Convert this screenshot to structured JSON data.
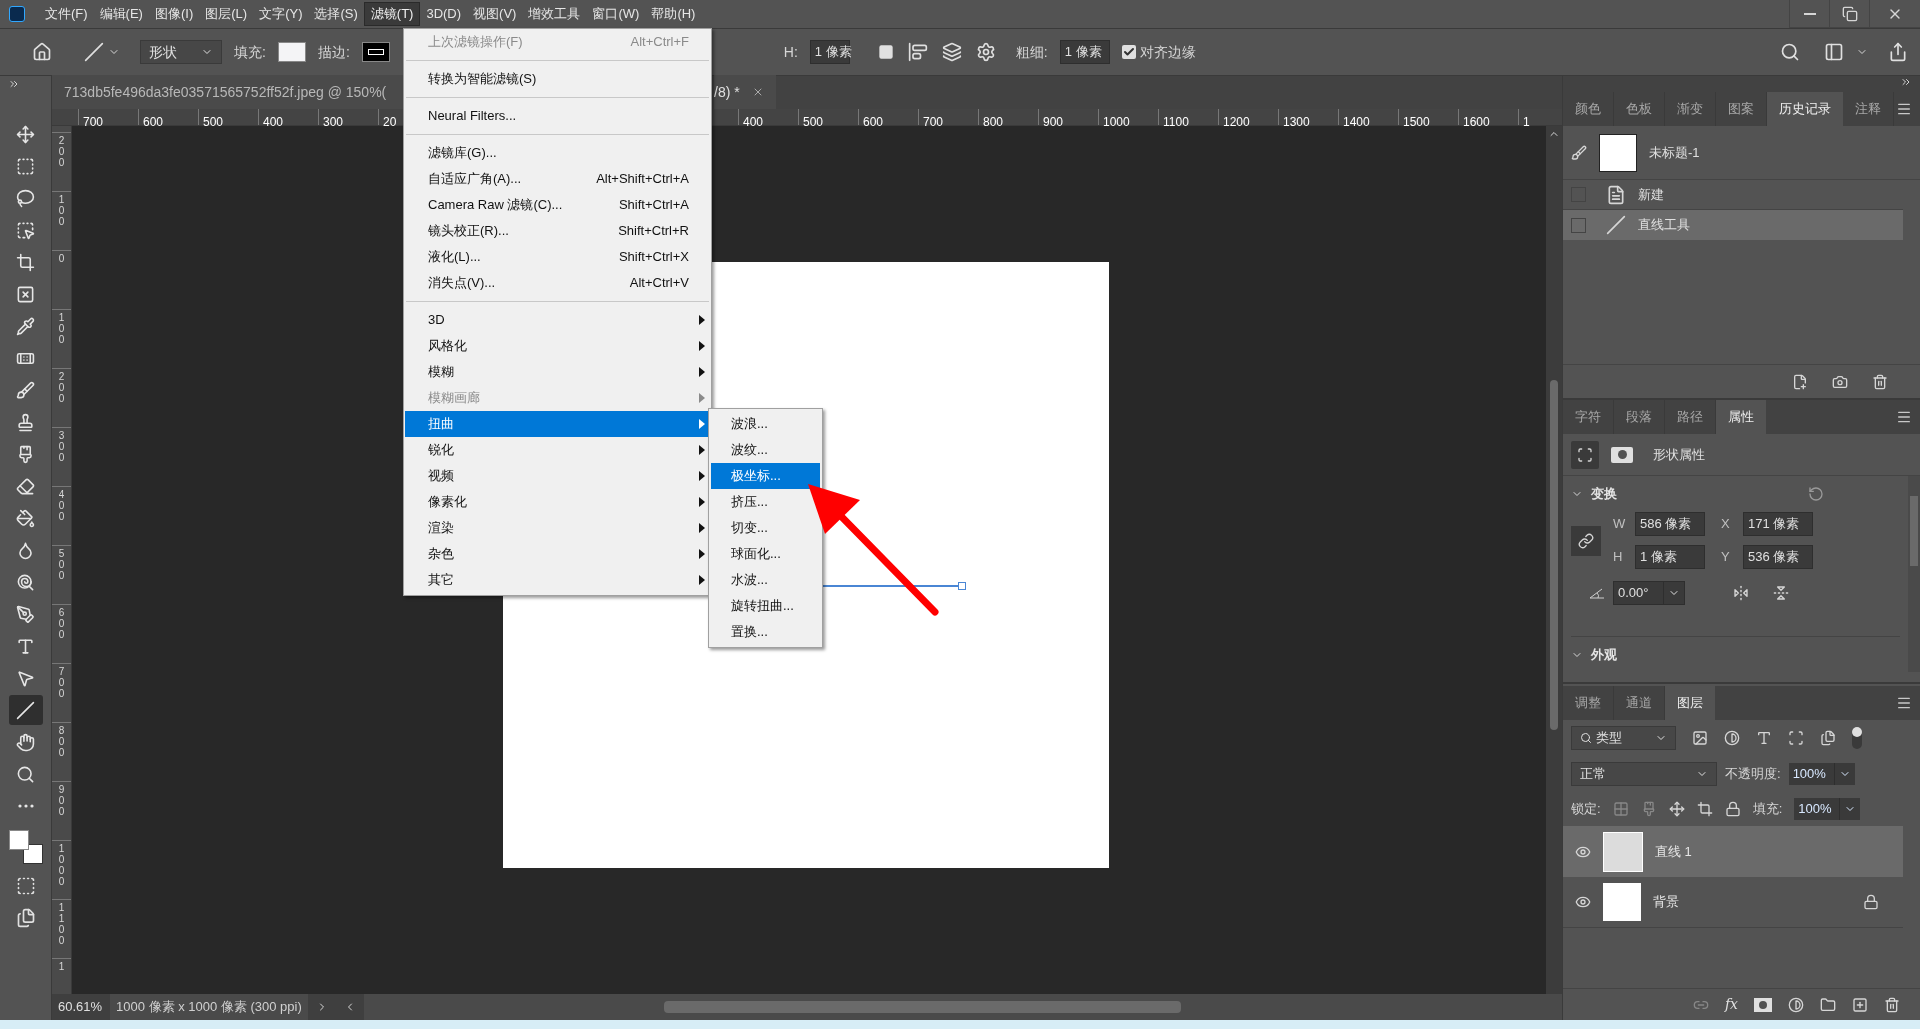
{
  "menu_bar": {
    "items": [
      {
        "label": "文件(F)",
        "selected": false
      },
      {
        "label": "编辑(E)",
        "selected": false
      },
      {
        "label": "图像(I)",
        "selected": false
      },
      {
        "label": "图层(L)",
        "selected": false
      },
      {
        "label": "文字(Y)",
        "selected": false
      },
      {
        "label": "选择(S)",
        "selected": false
      },
      {
        "label": "滤镜(T)",
        "selected": true
      },
      {
        "label": "3D(D)",
        "selected": false
      },
      {
        "label": "视图(V)",
        "selected": false
      },
      {
        "label": "增效工具",
        "selected": false
      },
      {
        "label": "窗口(W)",
        "selected": false
      },
      {
        "label": "帮助(H)",
        "selected": false
      }
    ]
  },
  "options_bar": {
    "shape_mode": "形状",
    "fill_label": "填充:",
    "stroke_label": "描边:",
    "h_label": "H:",
    "h_value": "1 像素",
    "weight_label": "粗细:",
    "weight_value": "1 像素",
    "align_edges": {
      "label": "对齐边缘",
      "checked": true
    }
  },
  "document_tab": {
    "title_start": "713db5fe496da3fe03571565752ff52f.jpeg @ 150%(",
    "title_end": "/8) *"
  },
  "ruler": {
    "left_labels": [
      "700",
      "600",
      "500",
      "400",
      "300",
      "20"
    ],
    "right_labels": [
      "400",
      "500",
      "600",
      "700",
      "800",
      "900",
      "1000",
      "1100",
      "1200",
      "1300",
      "1400",
      "1500",
      "1600",
      "1"
    ],
    "vertical_labels": [
      "200",
      "100",
      "0",
      "100",
      "200",
      "300",
      "400",
      "500",
      "600",
      "700",
      "800",
      "900",
      "1000",
      "1100",
      "1"
    ]
  },
  "tools": [
    {
      "selected": false
    },
    {
      "selected": false
    },
    {
      "selected": false
    },
    {
      "selected": false
    },
    {
      "selected": false
    },
    {
      "selected": false
    },
    {
      "selected": false
    },
    {
      "selected": false
    },
    {
      "selected": false
    },
    {
      "selected": false
    },
    {
      "selected": false
    },
    {
      "selected": false
    },
    {
      "selected": false
    },
    {
      "selected": false
    },
    {
      "selected": false
    },
    {
      "selected": false
    },
    {
      "selected": false
    },
    {
      "selected": false
    },
    {
      "selected": true
    },
    {
      "selected": false
    },
    {
      "selected": false
    },
    {
      "selected": false
    }
  ],
  "filter_menu": {
    "items": [
      {
        "kind": "item",
        "label": "上次滤镜操作(F)",
        "shortcut": "Alt+Ctrl+F",
        "disabled": true
      },
      {
        "kind": "separator"
      },
      {
        "kind": "item",
        "label": "转换为智能滤镜(S)",
        "disabled": false
      },
      {
        "kind": "separator"
      },
      {
        "kind": "item",
        "label": "Neural Filters...",
        "disabled": false
      },
      {
        "kind": "separator"
      },
      {
        "kind": "item",
        "label": "滤镜库(G)...",
        "disabled": false
      },
      {
        "kind": "item",
        "label": "自适应广角(A)...",
        "shortcut": "Alt+Shift+Ctrl+A",
        "disabled": false
      },
      {
        "kind": "item",
        "label": "Camera Raw 滤镜(C)...",
        "shortcut": "Shift+Ctrl+A",
        "disabled": false
      },
      {
        "kind": "item",
        "label": "镜头校正(R)...",
        "shortcut": "Shift+Ctrl+R",
        "disabled": false
      },
      {
        "kind": "item",
        "label": "液化(L)...",
        "shortcut": "Shift+Ctrl+X",
        "disabled": false
      },
      {
        "kind": "item",
        "label": "消失点(V)...",
        "shortcut": "Alt+Ctrl+V",
        "disabled": false
      },
      {
        "kind": "separator"
      },
      {
        "kind": "submenu",
        "label": "3D",
        "disabled": false,
        "selected": false
      },
      {
        "kind": "submenu",
        "label": "风格化",
        "disabled": false,
        "selected": false
      },
      {
        "kind": "submenu",
        "label": "模糊",
        "disabled": false,
        "selected": false
      },
      {
        "kind": "submenu",
        "label": "模糊画廊",
        "disabled": true,
        "selected": false
      },
      {
        "kind": "submenu",
        "label": "扭曲",
        "disabled": false,
        "selected": true
      },
      {
        "kind": "submenu",
        "label": "锐化",
        "disabled": false,
        "selected": false
      },
      {
        "kind": "submenu",
        "label": "视频",
        "disabled": false,
        "selected": false
      },
      {
        "kind": "submenu",
        "label": "像素化",
        "disabled": false,
        "selected": false
      },
      {
        "kind": "submenu",
        "label": "渲染",
        "disabled": false,
        "selected": false
      },
      {
        "kind": "submenu",
        "label": "杂色",
        "disabled": false,
        "selected": false
      },
      {
        "kind": "submenu",
        "label": "其它",
        "disabled": false,
        "selected": false
      }
    ]
  },
  "distort_submenu": {
    "items": [
      {
        "label": "波浪...",
        "selected": false
      },
      {
        "label": "波纹...",
        "selected": false
      },
      {
        "label": "极坐标...",
        "selected": true
      },
      {
        "label": "挤压...",
        "selected": false
      },
      {
        "label": "切变...",
        "selected": false
      },
      {
        "label": "球面化...",
        "selected": false
      },
      {
        "label": "水波...",
        "selected": false
      },
      {
        "label": "旋转扭曲...",
        "selected": false
      },
      {
        "label": "置换...",
        "selected": false
      }
    ]
  },
  "status_bar": {
    "zoom": "60.61%",
    "doc_info": "1000 像素 x 1000 像素 (300 ppi)"
  },
  "history_panel": {
    "tabs": [
      {
        "label": "颜色",
        "selected": false
      },
      {
        "label": "色板",
        "selected": false
      },
      {
        "label": "渐变",
        "selected": false
      },
      {
        "label": "图案",
        "selected": false
      },
      {
        "label": "历史记录",
        "selected": true
      },
      {
        "label": "注释",
        "selected": false
      }
    ],
    "snapshot": "未标题-1",
    "steps": [
      {
        "label": "新建",
        "kind": "document",
        "selected": false
      },
      {
        "label": "直线工具",
        "kind": "line",
        "selected": true
      }
    ]
  },
  "properties_panel": {
    "tabs": [
      {
        "label": "字符",
        "selected": false
      },
      {
        "label": "段落",
        "selected": false
      },
      {
        "label": "路径",
        "selected": false
      },
      {
        "label": "属性",
        "selected": true
      }
    ],
    "title": "形状属性",
    "transform": {
      "heading": "变换",
      "w_label": "W",
      "w": "586 像素",
      "x_label": "X",
      "x": "171 像素",
      "h_label": "H",
      "h": "1 像素",
      "y_label": "Y",
      "y": "536 像素",
      "angle": "0.00°"
    },
    "appearance": {
      "heading": "外观"
    }
  },
  "layers_panel": {
    "tabs": [
      {
        "label": "调整",
        "selected": false
      },
      {
        "label": "通道",
        "selected": false
      },
      {
        "label": "图层",
        "selected": true
      }
    ],
    "filter": "类型",
    "blend_mode": "正常",
    "opacity_label": "不透明度:",
    "opacity": "100%",
    "lock_label": "锁定:",
    "fill_label": "填充:",
    "fill": "100%",
    "layers": [
      {
        "name": "直线 1",
        "kind": "shape",
        "selected": true,
        "locked": false
      },
      {
        "name": "背景",
        "kind": "background",
        "selected": false,
        "locked": true
      }
    ],
    "fx_label": "fx"
  }
}
